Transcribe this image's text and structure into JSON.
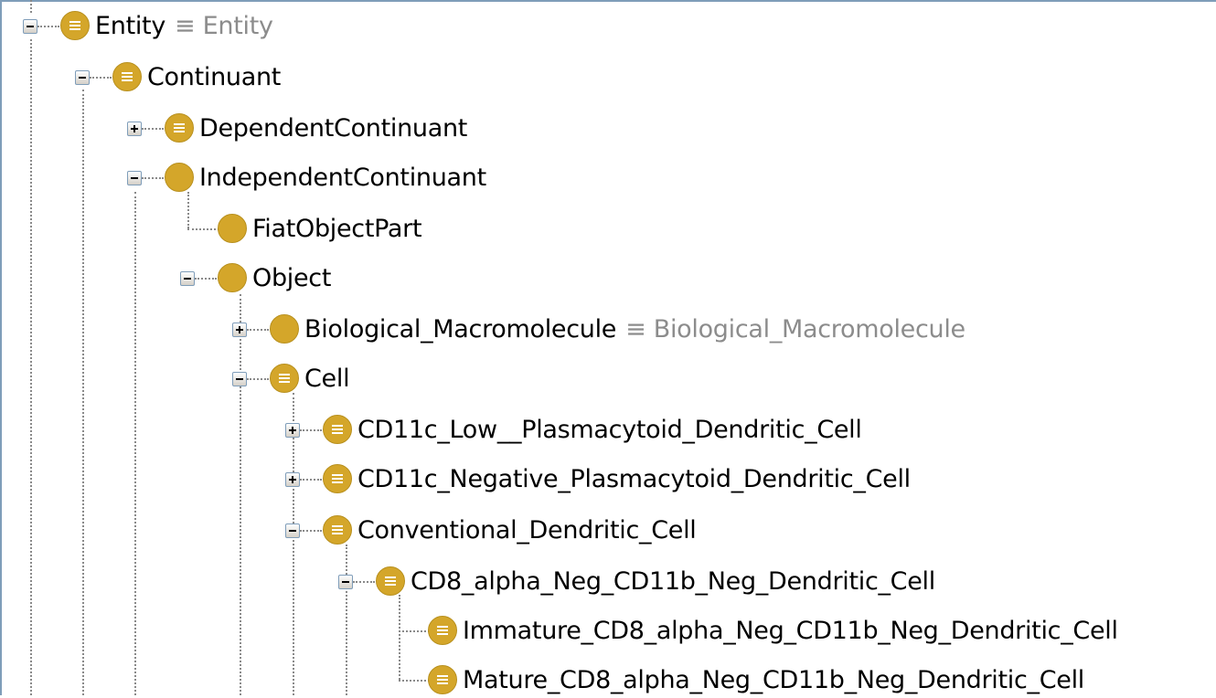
{
  "tree": {
    "entity": {
      "label": "Entity",
      "equiv": "≡ Entity"
    },
    "continuant": {
      "label": "Continuant"
    },
    "dependent_continuant": {
      "label": "DependentContinuant"
    },
    "independent_continuant": {
      "label": "IndependentContinuant"
    },
    "fiat_object_part": {
      "label": "FiatObjectPart"
    },
    "object": {
      "label": "Object"
    },
    "biological_macromolecule": {
      "label": "Biological_Macromolecule",
      "equiv": "≡ Biological_Macromolecule"
    },
    "cell": {
      "label": "Cell"
    },
    "cd11c_low": {
      "label": "CD11c_Low__Plasmacytoid_Dendritic_Cell"
    },
    "cd11c_negative": {
      "label": "CD11c_Negative_Plasmacytoid_Dendritic_Cell"
    },
    "conventional_dc": {
      "label": "Conventional_Dendritic_Cell"
    },
    "cd8_alpha_neg": {
      "label": "CD8_alpha_Neg_CD11b_Neg_Dendritic_Cell"
    },
    "immature_cd8": {
      "label": "Immature_CD8_alpha_Neg_CD11b_Neg_Dendritic_Cell"
    },
    "mature_cd8": {
      "label": "Mature_CD8_alpha_Neg_CD11b_Neg_Dendritic_Cell"
    }
  },
  "icons": {
    "defined_class": "defined-class-icon",
    "primitive_class": "primitive-class-icon",
    "expand": "plus-toggle-icon",
    "collapse": "minus-toggle-icon"
  },
  "colors": {
    "class_icon": "#d4a62a",
    "equiv_text": "#8c8c8c",
    "frame": "#7f9db9"
  }
}
